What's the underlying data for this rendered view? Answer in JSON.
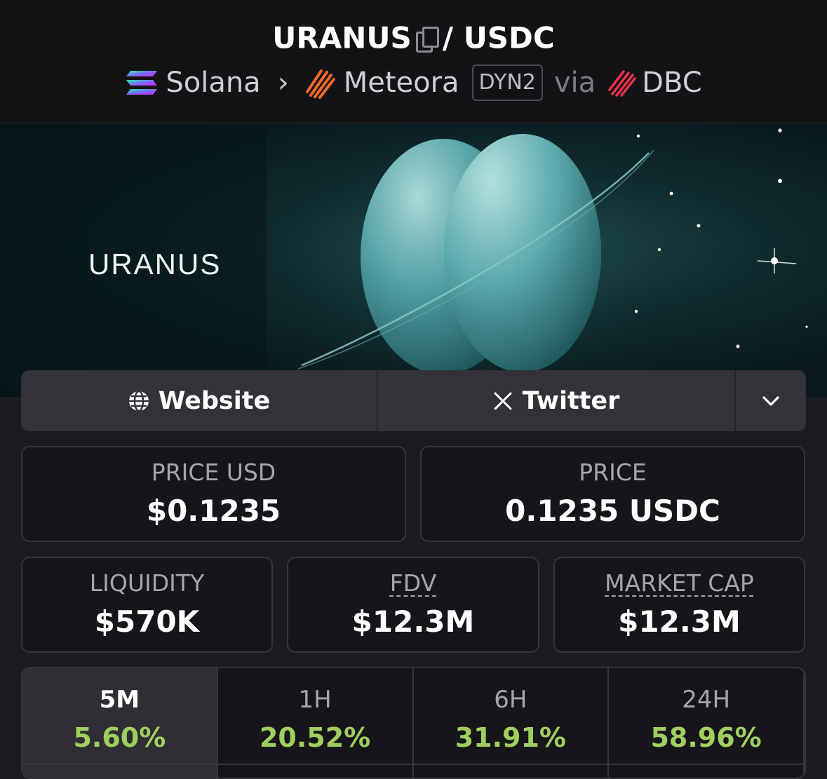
{
  "header": {
    "base_token": "URANUS",
    "separator": "/",
    "quote_token": "USDC",
    "chain": "Solana",
    "chevron": "›",
    "dex": "Meteora",
    "dex_badge": "DYN2",
    "via": "via",
    "launchpad": "DBC"
  },
  "banner": {
    "text": "URANUS"
  },
  "links": {
    "website": "Website",
    "twitter": "Twitter"
  },
  "stats": {
    "price_usd": {
      "label": "PRICE USD",
      "value": "$0.1235"
    },
    "price": {
      "label": "PRICE",
      "value": "0.1235 USDC"
    },
    "liquidity": {
      "label": "LIQUIDITY",
      "value": "$570K"
    },
    "fdv": {
      "label": "FDV",
      "value": "$12.3M"
    },
    "market_cap": {
      "label": "MARKET CAP",
      "value": "$12.3M"
    }
  },
  "timeframes": [
    {
      "label": "5M",
      "value": "5.60%",
      "active": true
    },
    {
      "label": "1H",
      "value": "20.52%",
      "active": false
    },
    {
      "label": "6H",
      "value": "31.91%",
      "active": false
    },
    {
      "label": "24H",
      "value": "58.96%",
      "active": false
    }
  ],
  "colors": {
    "positive": "#9fcf5f",
    "background": "#1b1c22",
    "accent_meteora": "#f46a2c",
    "accent_dbc": "#e8334a"
  }
}
